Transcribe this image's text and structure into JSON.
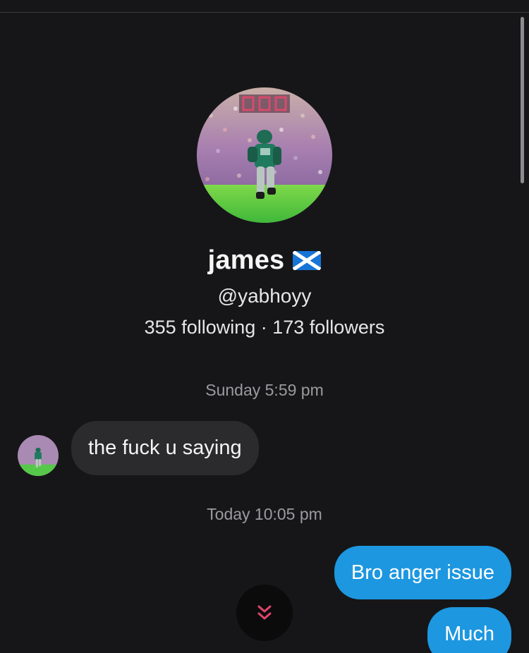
{
  "profile": {
    "name": "james",
    "flag_icon": "scotland-flag-icon",
    "handle": "@yabhoyy",
    "stats": "355 following · 173 followers"
  },
  "conversation": {
    "timestamps": [
      "Sunday 5:59 pm",
      "Today 10:05 pm"
    ],
    "incoming": [
      {
        "text": "the fuck u saying"
      }
    ],
    "outgoing": [
      {
        "text": "Bro anger issue"
      },
      {
        "text": "Much"
      }
    ]
  },
  "controls": {
    "scroll_down_icon": "double-chevron-down-icon"
  },
  "colors": {
    "background": "#161618",
    "incoming_bubble": "#2b2b2e",
    "outgoing_bubble": "#1d97e0",
    "accent_chevron": "#e0456a"
  }
}
